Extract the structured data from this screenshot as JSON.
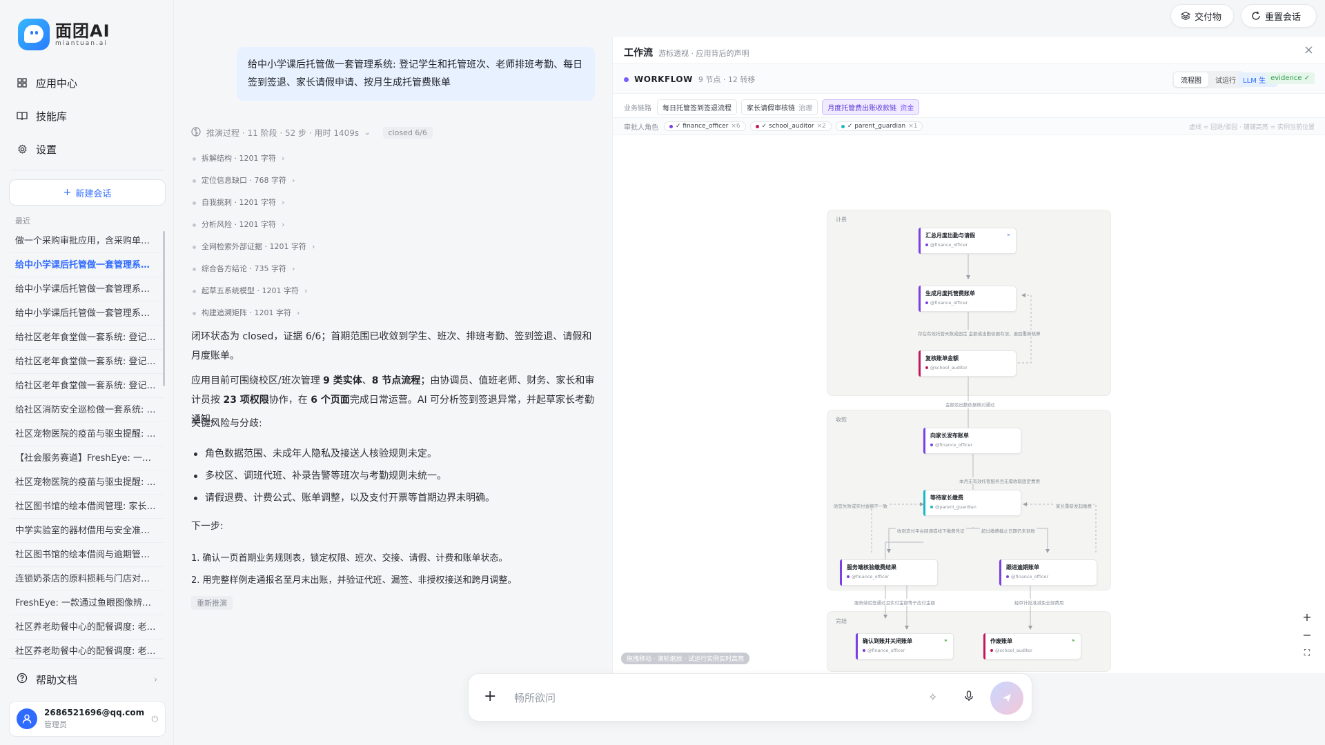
{
  "brand": {
    "name": "面团AI",
    "subname": "miantuan.ai"
  },
  "sidebar": {
    "nav": [
      {
        "label": "应用中心",
        "icon": "grid-icon"
      },
      {
        "label": "技能库",
        "icon": "book-icon"
      },
      {
        "label": "设置",
        "icon": "gear-icon"
      }
    ],
    "new_chat_label": "新建会话",
    "recent_label": "最近",
    "history": [
      "做一个采购审批应用，含采购单、经…",
      "给中小学课后托管做一套管理系统: …",
      "给中小学课后托管做一套管理系统: …",
      "给中小学课后托管做一套管理系统: …",
      "给社区老年食堂做一套系统: 登记就…",
      "给社区老年食堂做一套系统: 登记就…",
      "给社区老年食堂做一套系统: 登记就…",
      "给社区消防安全巡检做一套系统: 登…",
      "社区宠物医院的疫苗与驱虫提醒: 建…",
      "【社会服务赛道】FreshEye: 一款通…",
      "社区宠物医院的疫苗与驱虫提醒: 建…",
      "社区图书馆的绘本借阅管理: 家长预…",
      "中学实验室的器材借用与安全准入: …",
      "社区图书馆的绘本借阅与逾期管理: …",
      "连锁奶茶店的原料损耗与门店对账: …",
      "FreshEye: 一款通过鱼眼图像辨别水…",
      "社区养老助餐中心的配餐调度: 老人…",
      "社区养老助餐中心的配餐调度: 老人…"
    ],
    "active_history_index": 1,
    "help_label": "帮助文档",
    "user": {
      "email": "2686521696@qq.com",
      "role": "管理员"
    }
  },
  "chat": {
    "user_message": "给中小学课后托管做一套管理系统: 登记学生和托管班次、老师排班考勤、每日签到签退、家长请假申请、按月生成托管费账单",
    "reasoning": {
      "summary": "推演过程 · 11 阶段 · 52 步 · 用时 1409s",
      "badge": "closed 6/6"
    },
    "steps": [
      "拆解结构 · 1201 字符",
      "定位信息缺口 · 768 字符",
      "自我挑刺 · 1201 字符",
      "分析风险 · 1201 字符",
      "全网检索外部证据 · 1201 字符",
      "综合各方结论 · 735 字符",
      "起草五系统模型 · 1201 字符",
      "构建追溯矩阵 · 1201 字符"
    ],
    "answer": {
      "p1_a": "闭环状态为 ",
      "p1_b": "closed",
      "p1_c": "，证据 ",
      "p1_d": "6/6",
      "p1_e": "；首期范围已收敛到学生、班次、排班考勤、签到签退、请假和月度账单。",
      "p2_a": "应用目前可围绕校区/班次管理 ",
      "p2_b": "9 类实体",
      "p2_c": "、",
      "p2_d": "8 节点流程",
      "p2_e": "；由协调员、值班老师、财务、家长和审计员按 ",
      "p2_f": "23 项权限",
      "p2_g": "协作，在 ",
      "p2_h": "6 个页面",
      "p2_i": "完成日常运营。AI 可分析签到签退异常，并起草家长考勤通知。",
      "risk_title": "关键风险与分歧:",
      "risks": [
        "角色数据范围、未成年人隐私及接送人核验规则未定。",
        "多校区、调班代班、补录告警等班次与考勤规则未统一。",
        "请假退费、计费公式、账单调整，以及支付开票等首期边界未明确。"
      ],
      "next_title": "下一步:",
      "next_steps": [
        "1. 确认一页首期业务规则表，锁定权限、班次、交接、请假、计费和账单状态。",
        "2. 用完整样例走通报名至月末出账，并验证代班、漏签、非授权接送和跨月调整。"
      ],
      "retry_label": "重新推演"
    }
  },
  "panel": {
    "title": "工作流",
    "subtitle": "游标透视 · 应用背后的声明",
    "workflow": {
      "name": "WORKFLOW",
      "meta": "9 节点 · 12 转移"
    },
    "view_tabs": [
      "流程图",
      "试运行"
    ],
    "active_view": 0,
    "badge_llm": "LLM 生成",
    "badge_evidence": "evidence ✓",
    "chain_label": "业务链路",
    "chains": [
      {
        "name": "每日托管签到签退流程",
        "tag": ""
      },
      {
        "name": "家长请假审核链",
        "tag": "治理"
      },
      {
        "name": "月度托管费出账收款链",
        "tag": "资金"
      }
    ],
    "active_chain": 2,
    "roles_label": "审批人角色",
    "roles": [
      {
        "name": "✓ finance_officer",
        "count": "×6",
        "color": "#7b3fe4"
      },
      {
        "name": "✓ school_auditor",
        "count": "×2",
        "color": "#c2185b"
      },
      {
        "name": "✓ parent_guardian",
        "count": "×1",
        "color": "#14b8c8"
      }
    ],
    "legend_hint": "虚线 = 回退/驳回 · 铺铺高亮 = 实例当前位置",
    "lanes": [
      "计费",
      "收款",
      "完结"
    ],
    "nodes": [
      {
        "title": "汇总月度出勤与请假",
        "role": "@finance_officer",
        "tag": "⚑"
      },
      {
        "title": "生成月度托管费账单",
        "role": "@finance_officer",
        "tag": ""
      },
      {
        "title": "复核账单金额",
        "role": "@school_auditor",
        "tag": ""
      },
      {
        "title": "向家长发布账单",
        "role": "@finance_officer",
        "tag": ""
      },
      {
        "title": "等待家长缴费",
        "role": "@parent_guardian",
        "tag": ""
      },
      {
        "title": "服务端核验缴费结果",
        "role": "@finance_officer",
        "tag": ""
      },
      {
        "title": "跟进逾期账单",
        "role": "@finance_officer",
        "tag": ""
      },
      {
        "title": "确认到账并关闭账单",
        "role": "@finance_officer",
        "tag": "⚑"
      },
      {
        "title": "作废账单",
        "role": "@school_auditor",
        "tag": "⚑"
      }
    ],
    "edges": [
      "存在有效托管天数或固定 金额或出勤依据有误，退回重新核算",
      "金额及出勤依据核对通过",
      "本月无有效托管服务且无需收取固定费用",
      "验签失败或实付金额不一致",
      "家长重新发起缴费",
      "收到支付平台回调或线下缴费凭证",
      "超过缴费截止日期仍未到账",
      "服务端验签通过且实付金额等于应付金额",
      "经审计批准减免全部费用"
    ],
    "canvas_hint": "拖拽移动 · 滚轮缩放 · 试运行实例实时高亮"
  },
  "top_buttons": {
    "deliver": "交付物",
    "reset": "重置会话"
  },
  "composer": {
    "placeholder": "畅所欲问"
  }
}
